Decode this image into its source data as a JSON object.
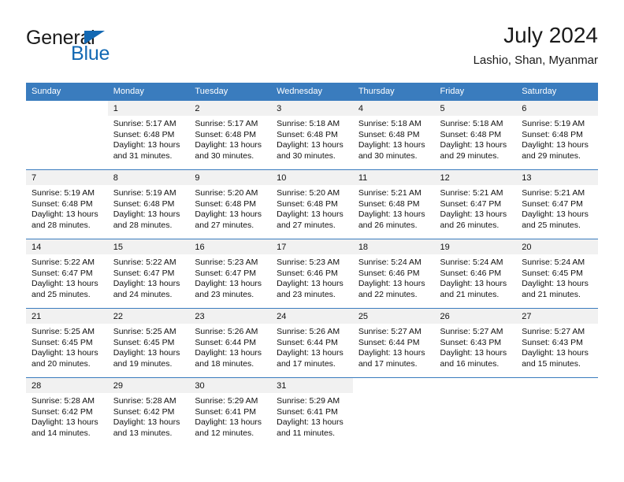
{
  "brand": {
    "name_top": "General",
    "name_bottom": "Blue",
    "accent_color": "#1268b3"
  },
  "header": {
    "title": "July 2024",
    "subtitle": "Lashio, Shan, Myanmar"
  },
  "calendar": {
    "header_bg": "#3a7cbe",
    "daynum_bg": "#f1f1f1",
    "weekdays": [
      "Sunday",
      "Monday",
      "Tuesday",
      "Wednesday",
      "Thursday",
      "Friday",
      "Saturday"
    ],
    "weeks": [
      [
        {
          "day": "",
          "blank": true,
          "sunrise": "",
          "sunset": "",
          "daylight1": "",
          "daylight2": ""
        },
        {
          "day": "1",
          "sunrise": "Sunrise: 5:17 AM",
          "sunset": "Sunset: 6:48 PM",
          "daylight1": "Daylight: 13 hours",
          "daylight2": "and 31 minutes."
        },
        {
          "day": "2",
          "sunrise": "Sunrise: 5:17 AM",
          "sunset": "Sunset: 6:48 PM",
          "daylight1": "Daylight: 13 hours",
          "daylight2": "and 30 minutes."
        },
        {
          "day": "3",
          "sunrise": "Sunrise: 5:18 AM",
          "sunset": "Sunset: 6:48 PM",
          "daylight1": "Daylight: 13 hours",
          "daylight2": "and 30 minutes."
        },
        {
          "day": "4",
          "sunrise": "Sunrise: 5:18 AM",
          "sunset": "Sunset: 6:48 PM",
          "daylight1": "Daylight: 13 hours",
          "daylight2": "and 30 minutes."
        },
        {
          "day": "5",
          "sunrise": "Sunrise: 5:18 AM",
          "sunset": "Sunset: 6:48 PM",
          "daylight1": "Daylight: 13 hours",
          "daylight2": "and 29 minutes."
        },
        {
          "day": "6",
          "sunrise": "Sunrise: 5:19 AM",
          "sunset": "Sunset: 6:48 PM",
          "daylight1": "Daylight: 13 hours",
          "daylight2": "and 29 minutes."
        }
      ],
      [
        {
          "day": "7",
          "sunrise": "Sunrise: 5:19 AM",
          "sunset": "Sunset: 6:48 PM",
          "daylight1": "Daylight: 13 hours",
          "daylight2": "and 28 minutes."
        },
        {
          "day": "8",
          "sunrise": "Sunrise: 5:19 AM",
          "sunset": "Sunset: 6:48 PM",
          "daylight1": "Daylight: 13 hours",
          "daylight2": "and 28 minutes."
        },
        {
          "day": "9",
          "sunrise": "Sunrise: 5:20 AM",
          "sunset": "Sunset: 6:48 PM",
          "daylight1": "Daylight: 13 hours",
          "daylight2": "and 27 minutes."
        },
        {
          "day": "10",
          "sunrise": "Sunrise: 5:20 AM",
          "sunset": "Sunset: 6:48 PM",
          "daylight1": "Daylight: 13 hours",
          "daylight2": "and 27 minutes."
        },
        {
          "day": "11",
          "sunrise": "Sunrise: 5:21 AM",
          "sunset": "Sunset: 6:48 PM",
          "daylight1": "Daylight: 13 hours",
          "daylight2": "and 26 minutes."
        },
        {
          "day": "12",
          "sunrise": "Sunrise: 5:21 AM",
          "sunset": "Sunset: 6:47 PM",
          "daylight1": "Daylight: 13 hours",
          "daylight2": "and 26 minutes."
        },
        {
          "day": "13",
          "sunrise": "Sunrise: 5:21 AM",
          "sunset": "Sunset: 6:47 PM",
          "daylight1": "Daylight: 13 hours",
          "daylight2": "and 25 minutes."
        }
      ],
      [
        {
          "day": "14",
          "sunrise": "Sunrise: 5:22 AM",
          "sunset": "Sunset: 6:47 PM",
          "daylight1": "Daylight: 13 hours",
          "daylight2": "and 25 minutes."
        },
        {
          "day": "15",
          "sunrise": "Sunrise: 5:22 AM",
          "sunset": "Sunset: 6:47 PM",
          "daylight1": "Daylight: 13 hours",
          "daylight2": "and 24 minutes."
        },
        {
          "day": "16",
          "sunrise": "Sunrise: 5:23 AM",
          "sunset": "Sunset: 6:47 PM",
          "daylight1": "Daylight: 13 hours",
          "daylight2": "and 23 minutes."
        },
        {
          "day": "17",
          "sunrise": "Sunrise: 5:23 AM",
          "sunset": "Sunset: 6:46 PM",
          "daylight1": "Daylight: 13 hours",
          "daylight2": "and 23 minutes."
        },
        {
          "day": "18",
          "sunrise": "Sunrise: 5:24 AM",
          "sunset": "Sunset: 6:46 PM",
          "daylight1": "Daylight: 13 hours",
          "daylight2": "and 22 minutes."
        },
        {
          "day": "19",
          "sunrise": "Sunrise: 5:24 AM",
          "sunset": "Sunset: 6:46 PM",
          "daylight1": "Daylight: 13 hours",
          "daylight2": "and 21 minutes."
        },
        {
          "day": "20",
          "sunrise": "Sunrise: 5:24 AM",
          "sunset": "Sunset: 6:45 PM",
          "daylight1": "Daylight: 13 hours",
          "daylight2": "and 21 minutes."
        }
      ],
      [
        {
          "day": "21",
          "sunrise": "Sunrise: 5:25 AM",
          "sunset": "Sunset: 6:45 PM",
          "daylight1": "Daylight: 13 hours",
          "daylight2": "and 20 minutes."
        },
        {
          "day": "22",
          "sunrise": "Sunrise: 5:25 AM",
          "sunset": "Sunset: 6:45 PM",
          "daylight1": "Daylight: 13 hours",
          "daylight2": "and 19 minutes."
        },
        {
          "day": "23",
          "sunrise": "Sunrise: 5:26 AM",
          "sunset": "Sunset: 6:44 PM",
          "daylight1": "Daylight: 13 hours",
          "daylight2": "and 18 minutes."
        },
        {
          "day": "24",
          "sunrise": "Sunrise: 5:26 AM",
          "sunset": "Sunset: 6:44 PM",
          "daylight1": "Daylight: 13 hours",
          "daylight2": "and 17 minutes."
        },
        {
          "day": "25",
          "sunrise": "Sunrise: 5:27 AM",
          "sunset": "Sunset: 6:44 PM",
          "daylight1": "Daylight: 13 hours",
          "daylight2": "and 17 minutes."
        },
        {
          "day": "26",
          "sunrise": "Sunrise: 5:27 AM",
          "sunset": "Sunset: 6:43 PM",
          "daylight1": "Daylight: 13 hours",
          "daylight2": "and 16 minutes."
        },
        {
          "day": "27",
          "sunrise": "Sunrise: 5:27 AM",
          "sunset": "Sunset: 6:43 PM",
          "daylight1": "Daylight: 13 hours",
          "daylight2": "and 15 minutes."
        }
      ],
      [
        {
          "day": "28",
          "sunrise": "Sunrise: 5:28 AM",
          "sunset": "Sunset: 6:42 PM",
          "daylight1": "Daylight: 13 hours",
          "daylight2": "and 14 minutes."
        },
        {
          "day": "29",
          "sunrise": "Sunrise: 5:28 AM",
          "sunset": "Sunset: 6:42 PM",
          "daylight1": "Daylight: 13 hours",
          "daylight2": "and 13 minutes."
        },
        {
          "day": "30",
          "sunrise": "Sunrise: 5:29 AM",
          "sunset": "Sunset: 6:41 PM",
          "daylight1": "Daylight: 13 hours",
          "daylight2": "and 12 minutes."
        },
        {
          "day": "31",
          "sunrise": "Sunrise: 5:29 AM",
          "sunset": "Sunset: 6:41 PM",
          "daylight1": "Daylight: 13 hours",
          "daylight2": "and 11 minutes."
        },
        {
          "day": "",
          "blank": true,
          "sunrise": "",
          "sunset": "",
          "daylight1": "",
          "daylight2": ""
        },
        {
          "day": "",
          "blank": true,
          "sunrise": "",
          "sunset": "",
          "daylight1": "",
          "daylight2": ""
        },
        {
          "day": "",
          "blank": true,
          "sunrise": "",
          "sunset": "",
          "daylight1": "",
          "daylight2": ""
        }
      ]
    ]
  }
}
